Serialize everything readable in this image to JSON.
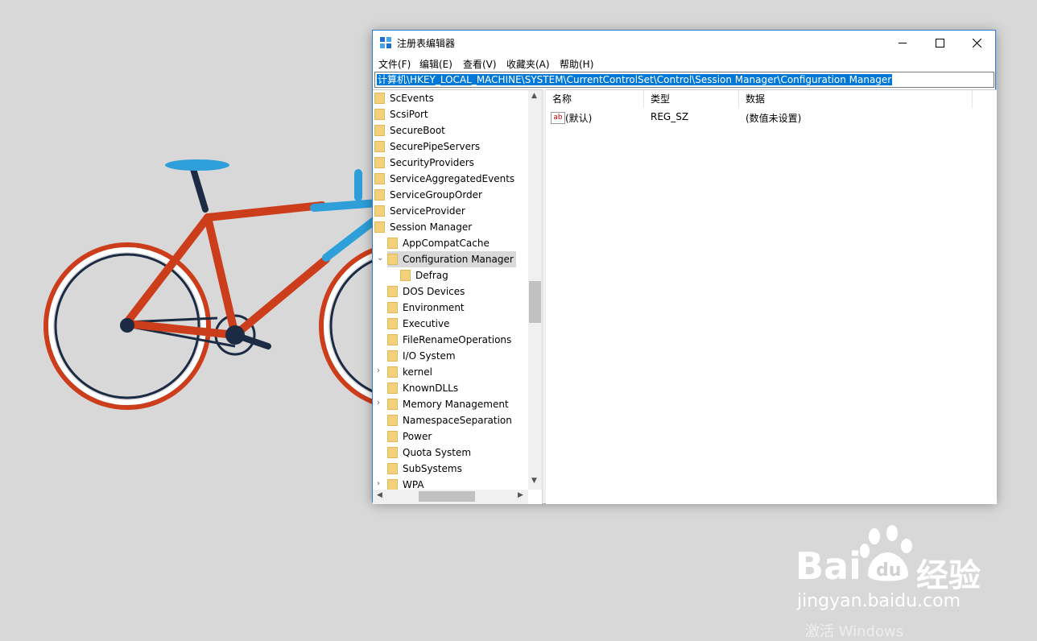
{
  "window": {
    "title": "注册表编辑器",
    "minimize_label": "—",
    "maximize_label": "☐",
    "close_label": "✕"
  },
  "menu": [
    "文件(F)",
    "编辑(E)",
    "查看(V)",
    "收藏夹(A)",
    "帮助(H)"
  ],
  "address": "计算机\\HKEY_LOCAL_MACHINE\\SYSTEM\\CurrentControlSet\\Control\\Session Manager\\Configuration Manager",
  "tree": [
    {
      "label": "ScEvents",
      "depth": 0
    },
    {
      "label": "ScsiPort",
      "depth": 0
    },
    {
      "label": "SecureBoot",
      "depth": 0
    },
    {
      "label": "SecurePipeServers",
      "depth": 0
    },
    {
      "label": "SecurityProviders",
      "depth": 0
    },
    {
      "label": "ServiceAggregatedEvents",
      "depth": 0
    },
    {
      "label": "ServiceGroupOrder",
      "depth": 0
    },
    {
      "label": "ServiceProvider",
      "depth": 0
    },
    {
      "label": "Session Manager",
      "depth": 0
    },
    {
      "label": "AppCompatCache",
      "depth": 1
    },
    {
      "label": "Configuration Manager",
      "depth": 1,
      "selected": true,
      "expanded": true
    },
    {
      "label": "Defrag",
      "depth": 2
    },
    {
      "label": "DOS Devices",
      "depth": 1
    },
    {
      "label": "Environment",
      "depth": 1
    },
    {
      "label": "Executive",
      "depth": 1
    },
    {
      "label": "FileRenameOperations",
      "depth": 1
    },
    {
      "label": "I/O System",
      "depth": 1
    },
    {
      "label": "kernel",
      "depth": 1,
      "collapsed": true
    },
    {
      "label": "KnownDLLs",
      "depth": 1
    },
    {
      "label": "Memory Management",
      "depth": 1,
      "collapsed": true
    },
    {
      "label": "NamespaceSeparation",
      "depth": 1
    },
    {
      "label": "Power",
      "depth": 1
    },
    {
      "label": "Quota System",
      "depth": 1
    },
    {
      "label": "SubSystems",
      "depth": 1
    },
    {
      "label": "WPA",
      "depth": 1,
      "collapsed": true
    }
  ],
  "columns": {
    "name": "名称",
    "type": "类型",
    "data": "数据"
  },
  "values": [
    {
      "name": "(默认)",
      "type": "REG_SZ",
      "data": "(数值未设置)"
    }
  ],
  "value_icon_text": "ab",
  "watermark": {
    "brand": "Bai",
    "brand2": "经验",
    "url": "jingyan.baidu.com",
    "activate": "激活 Windows"
  },
  "colors": {
    "selection": "#0078d7",
    "folder": "#f3d17a",
    "bike_frame": "#cc3e1b",
    "bike_blue": "#2e9fd8",
    "bike_dark": "#1b2b44"
  }
}
